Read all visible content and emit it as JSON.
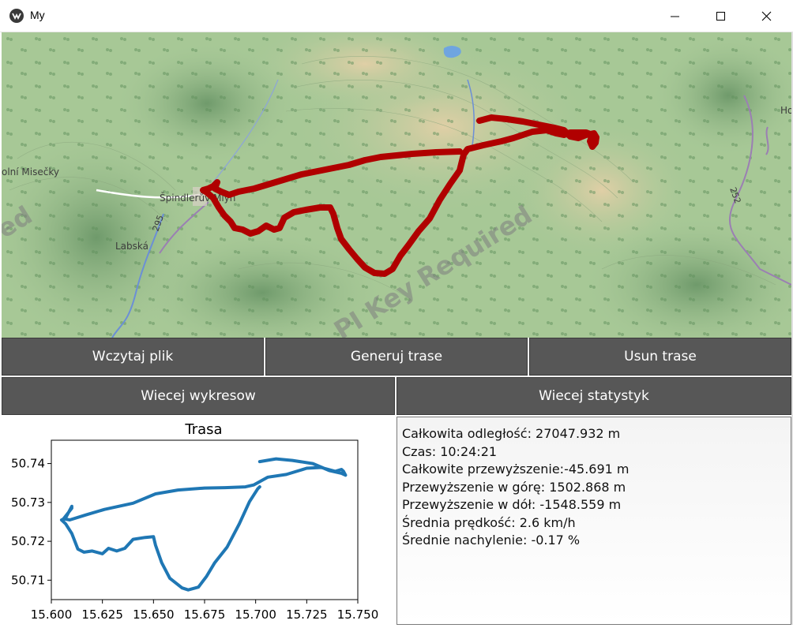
{
  "window": {
    "title": "My",
    "controls": [
      "minimize-icon",
      "maximize-icon",
      "close-icon"
    ]
  },
  "map": {
    "labels": {
      "spindleruv_mlyn": "Špindlerův Mlýn",
      "labska": "Labská",
      "misecky": "olní Misečky",
      "road_295": "295",
      "road_252": "252",
      "edge_ho": "Ho",
      "watermark": "PI Key Required",
      "watermark_left": "red"
    },
    "track_color": "#b00000"
  },
  "buttons": {
    "load_file": "Wczytaj plik",
    "generate_route": "Generuj trase",
    "remove_route": "Usun trase",
    "more_charts": "Wiecej wykresow",
    "more_stats": "Wiecej statystyk"
  },
  "stats": [
    "Całkowita odległość: 27047.932 m",
    "Czas: 10:24:21",
    "Całkowite przewyższenie:-45.691 m",
    "Przewyższenie w górę: 1502.868 m",
    "Przewyższenie w dół: -1548.559 m",
    "Średnia prędkość: 2.6 km/h",
    "Średnie nachylenie: -0.17 %"
  ],
  "chart_data": {
    "type": "line",
    "title": "Trasa",
    "xlabel": "",
    "ylabel": "",
    "xlim": [
      15.6,
      15.75
    ],
    "ylim": [
      50.705,
      50.746
    ],
    "x_ticks": [
      "15.600",
      "15.625",
      "15.650",
      "15.675",
      "15.700",
      "15.725",
      "15.750"
    ],
    "y_ticks": [
      "50.71",
      "50.72",
      "50.73",
      "50.74"
    ],
    "x_tick_values": [
      15.6,
      15.625,
      15.65,
      15.675,
      15.7,
      15.725,
      15.75
    ],
    "y_tick_values": [
      50.71,
      50.72,
      50.73,
      50.74
    ],
    "grid": false,
    "series": [
      {
        "color": "#1f77b4",
        "x": [
          15.702,
          15.71,
          15.718,
          15.728,
          15.736,
          15.742,
          15.744,
          15.743,
          15.742,
          15.739,
          15.732,
          15.725,
          15.715,
          15.706,
          15.699,
          15.695,
          15.685,
          15.675,
          15.662,
          15.651,
          15.64,
          15.626,
          15.617,
          15.609,
          15.606,
          15.61,
          15.61,
          15.607,
          15.605,
          15.607,
          15.61,
          15.613,
          15.616,
          15.62,
          15.625,
          15.628,
          15.632,
          15.636,
          15.64,
          15.646,
          15.65,
          15.651,
          15.654,
          15.658,
          15.664,
          15.667,
          15.672,
          15.676,
          15.68,
          15.686,
          15.692,
          15.697,
          15.701,
          15.702
        ],
        "y": [
          50.7405,
          50.7412,
          50.7408,
          50.74,
          50.7382,
          50.7375,
          50.737,
          50.738,
          50.7385,
          50.738,
          50.739,
          50.7388,
          50.7372,
          50.7365,
          50.7345,
          50.734,
          50.7338,
          50.7337,
          50.7332,
          50.7322,
          50.7298,
          50.7282,
          50.7268,
          50.7255,
          50.7258,
          50.7285,
          50.729,
          50.726,
          50.7255,
          50.7245,
          50.722,
          50.718,
          50.7172,
          50.7175,
          50.7168,
          50.7182,
          50.7175,
          50.7182,
          50.7205,
          50.721,
          50.7212,
          50.719,
          50.7145,
          50.7105,
          50.708,
          50.7075,
          50.7082,
          50.711,
          50.7145,
          50.7185,
          50.7245,
          50.7302,
          50.7335,
          50.734
        ]
      }
    ]
  }
}
